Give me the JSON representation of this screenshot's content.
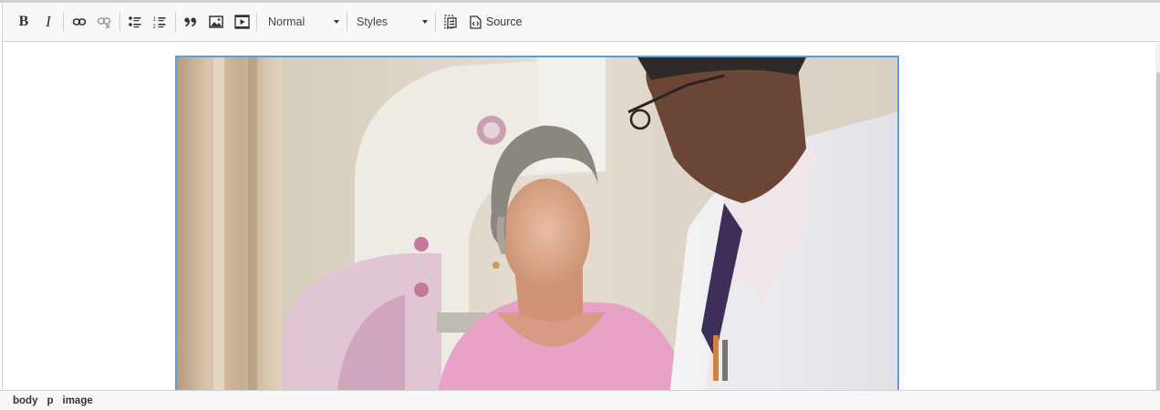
{
  "toolbar": {
    "bold_label": "B",
    "italic_label": "I",
    "format_combo": {
      "value": "Normal"
    },
    "styles_combo": {
      "value": "Styles"
    },
    "source_label": "Source",
    "icons": [
      "bold-icon",
      "italic-icon",
      "link-icon",
      "unlink-icon",
      "bulleted-list-icon",
      "numbered-list-icon",
      "blockquote-icon",
      "image-icon",
      "media-embed-icon",
      "show-blocks-icon",
      "source-icon"
    ]
  },
  "content": {
    "image": {
      "alt_subject": "doctor-and-patient-photo"
    }
  },
  "statusbar": {
    "path": [
      "body",
      "p",
      "image"
    ]
  },
  "colors": {
    "selection_border": "#5b9de0",
    "toolbar_bg": "#f8f8f8",
    "border": "#d1d1d1"
  }
}
